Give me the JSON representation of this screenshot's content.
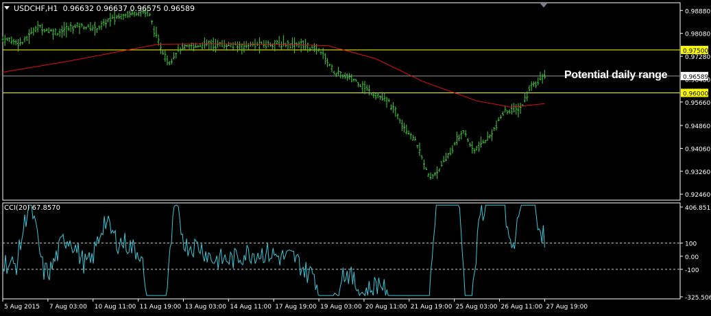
{
  "header": {
    "symbol": "USDCHF,H1",
    "ohlc": "0.96632 0.96637 0.96575 0.96589"
  },
  "annotation": "Potential daily range",
  "indicator": {
    "label": "CCI(20) 67.8570"
  },
  "colors": {
    "background": "#000000",
    "bars": "#3fcf3f",
    "ma": "#e01010",
    "levels": "#ffff00",
    "current_price_line": "#9a9a9a",
    "cci_line": "#3cc8d8",
    "grid_frame": "#ffffff"
  },
  "chart_data": [
    {
      "type": "ohlc",
      "title": "USDCHF,H1",
      "y_ticks": [
        0.9888,
        0.9808,
        0.9728,
        0.9648,
        0.9568,
        0.9486,
        0.9406,
        0.9326,
        0.9246
      ],
      "y_tick_labels": [
        "0.98880",
        "0.98080",
        "0.97280",
        "0.96480",
        "0.95660",
        "0.94860",
        "0.94060",
        "0.93260",
        "0.92460"
      ],
      "ylim": [
        0.9225,
        0.9915
      ],
      "x_tick_labels": [
        "5 Aug 2015",
        "7 Aug 03:00",
        "10 Aug 11:00",
        "11 Aug 19:00",
        "13 Aug 03:00",
        "14 Aug 11:00",
        "17 Aug 19:00",
        "19 Aug 03:00",
        "20 Aug 11:00",
        "21 Aug 19:00",
        "25 Aug 03:00",
        "26 Aug 11:00",
        "27 Aug 19:00"
      ],
      "horizontal_levels": [
        {
          "label": "0.97500",
          "value": 0.975,
          "color": "#ffff00"
        },
        {
          "label": "0.96000",
          "value": 0.96,
          "color": "#ffff00"
        }
      ],
      "current_price": {
        "label": "0.96589",
        "value": 0.96589
      },
      "close_path": [
        {
          "x": 0,
          "y": 0.9788
        },
        {
          "x": 0.03,
          "y": 0.9775
        },
        {
          "x": 0.05,
          "y": 0.9832
        },
        {
          "x": 0.08,
          "y": 0.981
        },
        {
          "x": 0.11,
          "y": 0.9835
        },
        {
          "x": 0.14,
          "y": 0.9825
        },
        {
          "x": 0.16,
          "y": 0.986
        },
        {
          "x": 0.19,
          "y": 0.988
        },
        {
          "x": 0.215,
          "y": 0.9885
        },
        {
          "x": 0.23,
          "y": 0.9775
        },
        {
          "x": 0.245,
          "y": 0.9705
        },
        {
          "x": 0.26,
          "y": 0.9752
        },
        {
          "x": 0.3,
          "y": 0.9772
        },
        {
          "x": 0.35,
          "y": 0.9764
        },
        {
          "x": 0.4,
          "y": 0.9772
        },
        {
          "x": 0.44,
          "y": 0.977
        },
        {
          "x": 0.47,
          "y": 0.9745
        },
        {
          "x": 0.49,
          "y": 0.967
        },
        {
          "x": 0.52,
          "y": 0.9645
        },
        {
          "x": 0.545,
          "y": 0.96
        },
        {
          "x": 0.57,
          "y": 0.9568
        },
        {
          "x": 0.59,
          "y": 0.9495
        },
        {
          "x": 0.61,
          "y": 0.943
        },
        {
          "x": 0.63,
          "y": 0.93
        },
        {
          "x": 0.645,
          "y": 0.9335
        },
        {
          "x": 0.665,
          "y": 0.941
        },
        {
          "x": 0.68,
          "y": 0.947
        },
        {
          "x": 0.695,
          "y": 0.9395
        },
        {
          "x": 0.72,
          "y": 0.945
        },
        {
          "x": 0.74,
          "y": 0.9535
        },
        {
          "x": 0.765,
          "y": 0.9545
        },
        {
          "x": 0.78,
          "y": 0.9625
        },
        {
          "x": 0.8,
          "y": 0.9658
        }
      ],
      "ma_path": [
        {
          "x": 0,
          "y": 0.9672
        },
        {
          "x": 0.1,
          "y": 0.9712
        },
        {
          "x": 0.18,
          "y": 0.9748
        },
        {
          "x": 0.23,
          "y": 0.977
        },
        {
          "x": 0.3,
          "y": 0.9772
        },
        {
          "x": 0.4,
          "y": 0.977
        },
        {
          "x": 0.48,
          "y": 0.9765
        },
        {
          "x": 0.55,
          "y": 0.972
        },
        {
          "x": 0.62,
          "y": 0.964
        },
        {
          "x": 0.7,
          "y": 0.9572
        },
        {
          "x": 0.75,
          "y": 0.955
        },
        {
          "x": 0.8,
          "y": 0.9562
        }
      ],
      "series": [
        {
          "name": "USDCHF,H1"
        }
      ]
    },
    {
      "type": "line",
      "title": "CCI(20) 67.8570",
      "y_tick_labels": [
        "406.8517",
        "100",
        "0.00",
        "-100",
        "-325.5062"
      ],
      "y_ticks": [
        406.8517,
        100,
        0,
        -100,
        -325.5062
      ],
      "ylim": [
        -325.5062,
        406.8517
      ],
      "reference_levels": [
        100,
        -100
      ],
      "series": [
        {
          "name": "CCI(20)",
          "last_value": 67.857
        }
      ]
    }
  ]
}
